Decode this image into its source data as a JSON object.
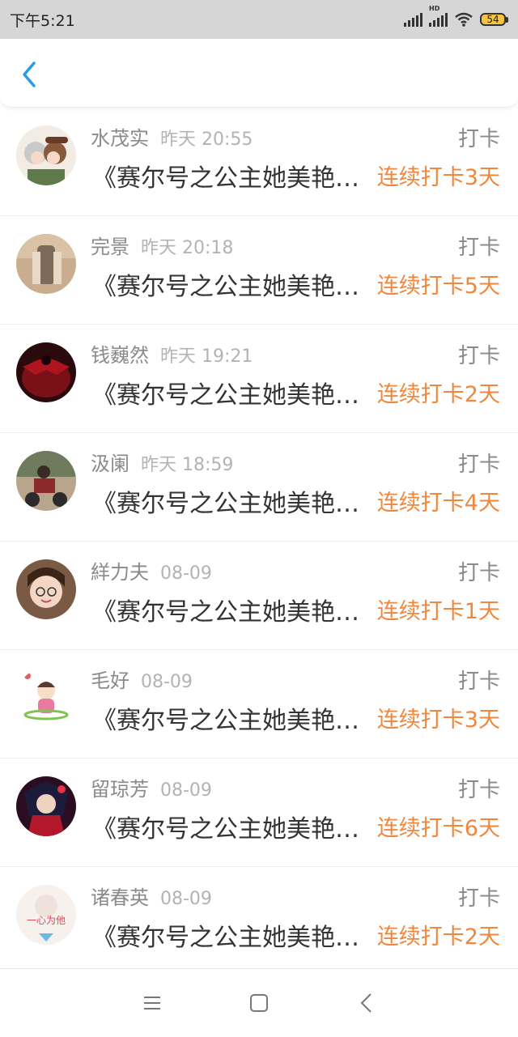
{
  "status_bar": {
    "time": "下午5:21",
    "battery_level": "54"
  },
  "nav": {
    "back_icon": "chevron-left-icon",
    "accent_color": "#2a9be8"
  },
  "entries": [
    {
      "name": "水茂实",
      "time": "昨天 20:55",
      "action": "打卡",
      "book": "《赛尔号之公主她美艳…",
      "streak": "连续打卡3天",
      "avatar_icon": "avatar-anime-girls"
    },
    {
      "name": "完景",
      "time": "昨天 20:18",
      "action": "打卡",
      "book": "《赛尔号之公主她美艳…",
      "streak": "连续打卡5天",
      "avatar_icon": "avatar-photo-figure"
    },
    {
      "name": "钱巍然",
      "time": "昨天 19:21",
      "action": "打卡",
      "book": "《赛尔号之公主她美艳…",
      "streak": "连续打卡2天",
      "avatar_icon": "avatar-dark-red-creature"
    },
    {
      "name": "汲阑",
      "time": "昨天 18:59",
      "action": "打卡",
      "book": "《赛尔号之公主她美艳…",
      "streak": "连续打卡4天",
      "avatar_icon": "avatar-motorcycle-rider"
    },
    {
      "name": "絴力夫",
      "time": "08-09",
      "action": "打卡",
      "book": "《赛尔号之公主她美艳…",
      "streak": "连续打卡1天",
      "avatar_icon": "avatar-girl-glasses"
    },
    {
      "name": "毛好",
      "time": "08-09",
      "action": "打卡",
      "book": "《赛尔号之公主她美艳…",
      "streak": "连续打卡3天",
      "avatar_icon": "avatar-cartoon-girl"
    },
    {
      "name": "留琼芳",
      "time": "08-09",
      "action": "打卡",
      "book": "《赛尔号之公主她美艳…",
      "streak": "连续打卡6天",
      "avatar_icon": "avatar-anime-warrior"
    },
    {
      "name": "诸春英",
      "time": "08-09",
      "action": "打卡",
      "book": "《赛尔号之公主她美艳…",
      "streak": "连续打卡2天",
      "avatar_icon": "avatar-text-heart",
      "avatar_text": "一心为他"
    }
  ],
  "colors": {
    "streak": "#f0873d",
    "name": "#8a8a8a",
    "time": "#b3b3b3",
    "book": "#333333",
    "status_bar_bg": "#d6d6d6"
  },
  "bottom_nav": {
    "icons": [
      "menu-icon",
      "home-square-icon",
      "back-triangle-icon"
    ]
  }
}
